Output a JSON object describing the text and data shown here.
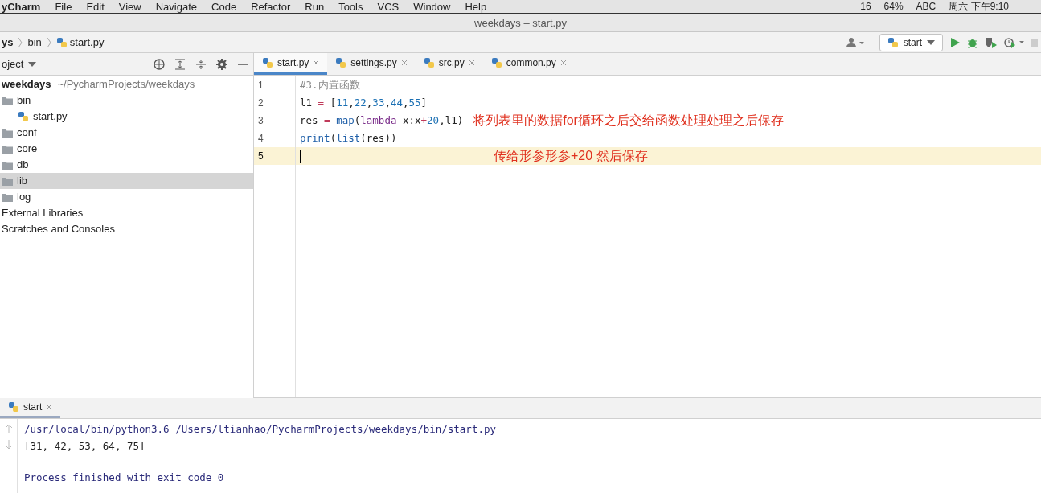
{
  "menu_bar": {
    "items": [
      "yCharm",
      "File",
      "Edit",
      "View",
      "Navigate",
      "Code",
      "Refactor",
      "Run",
      "Tools",
      "VCS",
      "Window",
      "Help"
    ],
    "status": [
      "16",
      "64%",
      "ABC",
      "周六 下午9:10"
    ]
  },
  "window": {
    "title": "weekdays – start.py"
  },
  "breadcrumbs": [
    "ys",
    "bin",
    "start.py"
  ],
  "run_config": {
    "label": "start"
  },
  "project_panel": {
    "title": "oject",
    "tree": [
      {
        "label": "weekdays",
        "path": "~/PycharmProjects/weekdays",
        "kind": "root",
        "selected": false,
        "children": [
          {
            "label": "bin",
            "kind": "folder",
            "selected": false,
            "children": [
              {
                "label": "start.py",
                "kind": "python",
                "selected": false
              }
            ]
          },
          {
            "label": "conf",
            "kind": "folder",
            "selected": false
          },
          {
            "label": "core",
            "kind": "folder",
            "selected": false
          },
          {
            "label": "db",
            "kind": "folder",
            "selected": false
          },
          {
            "label": "lib",
            "kind": "folder",
            "selected": true
          },
          {
            "label": "log",
            "kind": "folder",
            "selected": false
          }
        ]
      },
      {
        "label": "External Libraries",
        "kind": "plain",
        "selected": false
      },
      {
        "label": "Scratches and Consoles",
        "kind": "plain",
        "selected": false
      }
    ]
  },
  "editor_tabs": [
    {
      "label": "start.py",
      "selected": true
    },
    {
      "label": "settings.py",
      "selected": false
    },
    {
      "label": "src.py",
      "selected": false
    },
    {
      "label": "common.py",
      "selected": false
    }
  ],
  "editor": {
    "lines": [
      {
        "number": "1",
        "current": false,
        "tokens": [
          {
            "text": "#3.内置函数",
            "kind": "comment"
          }
        ]
      },
      {
        "number": "2",
        "current": false,
        "tokens": [
          {
            "text": "l1 ",
            "kind": "name"
          },
          {
            "text": "=",
            "kind": "op"
          },
          {
            "text": " [",
            "kind": "name"
          },
          {
            "text": "11",
            "kind": "num"
          },
          {
            "text": ",",
            "kind": "name"
          },
          {
            "text": "22",
            "kind": "num"
          },
          {
            "text": ",",
            "kind": "name"
          },
          {
            "text": "33",
            "kind": "num"
          },
          {
            "text": ",",
            "kind": "name"
          },
          {
            "text": "44",
            "kind": "num"
          },
          {
            "text": ",",
            "kind": "name"
          },
          {
            "text": "55",
            "kind": "num"
          },
          {
            "text": "]",
            "kind": "name"
          }
        ]
      },
      {
        "number": "3",
        "current": false,
        "tokens": [
          {
            "text": "res ",
            "kind": "name"
          },
          {
            "text": "= ",
            "kind": "op"
          },
          {
            "text": "map",
            "kind": "builtin"
          },
          {
            "text": "(",
            "kind": "name"
          },
          {
            "text": "lambda",
            "kind": "keyword"
          },
          {
            "text": " x:x",
            "kind": "name"
          },
          {
            "text": "+",
            "kind": "op"
          },
          {
            "text": "20",
            "kind": "num"
          },
          {
            "text": ",l1)",
            "kind": "name"
          }
        ],
        "note": "将列表里的数据for循环之后交给函数处理处理之后保存"
      },
      {
        "number": "4",
        "current": false,
        "tokens": [
          {
            "text": "print",
            "kind": "builtin"
          },
          {
            "text": "(",
            "kind": "name"
          },
          {
            "text": "list",
            "kind": "builtin"
          },
          {
            "text": "(res))",
            "kind": "name"
          }
        ]
      },
      {
        "number": "5",
        "current": true,
        "note": "传给形参形参+20 然后保存"
      }
    ]
  },
  "run_panel": {
    "tab": {
      "label": "start",
      "selected": true
    },
    "output": [
      {
        "text": "/usr/local/bin/python3.6 /Users/ltianhao/PycharmProjects/weekdays/bin/start.py",
        "kind": "command"
      },
      {
        "text": "[31, 42, 53, 64, 75]",
        "kind": "stdout"
      },
      {
        "text": "Process finished with exit code 0",
        "kind": "status"
      }
    ]
  }
}
